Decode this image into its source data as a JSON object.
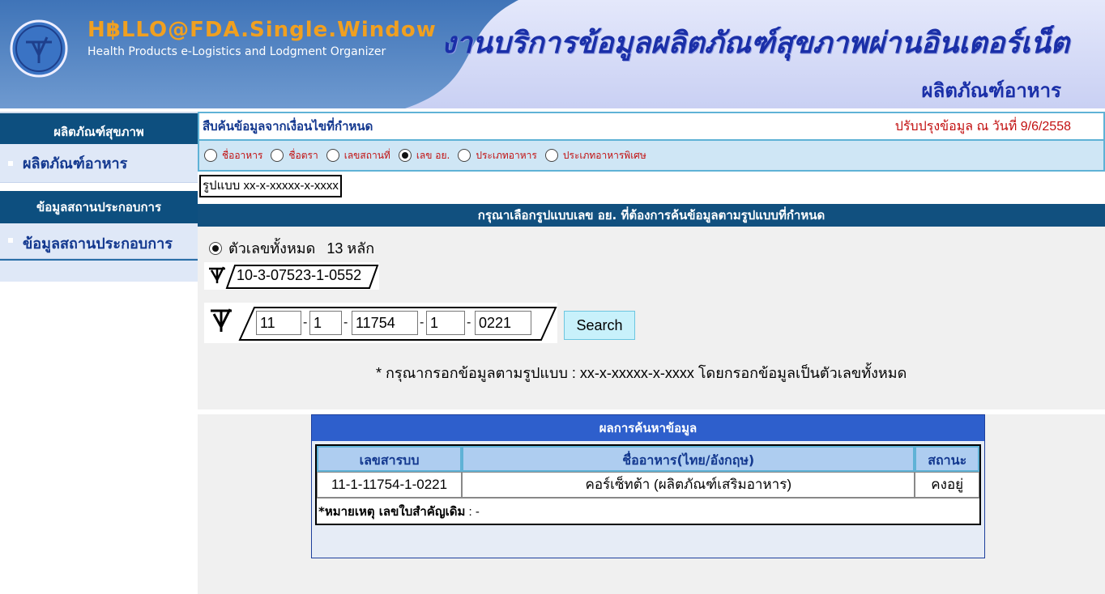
{
  "header": {
    "brand_title": "H฿LLO@FDA.Single.Window",
    "brand_subtitle": "Health Products e-Logistics and Lodgment Organizer",
    "title": "งานบริการข้อมูลผลิตภัณฑ์สุขภาพผ่านอินเตอร์เน็ต",
    "subtitle": "ผลิตภัณฑ์อาหาร"
  },
  "sidebar": {
    "section1_title": "ผลิตภัณฑ์สุขภาพ",
    "section1_item": "ผลิตภัณฑ์อาหาร",
    "section2_title": "ข้อมูลสถานประกอบการ",
    "section2_item": "ข้อมูลสถานประกอบการ"
  },
  "query": {
    "title": "สืบค้นข้อมูลจากเงื่อนไขที่กำหนด",
    "update_text": "ปรับปรุงข้อมูล ณ วันที่ 9/6/2558",
    "options": [
      {
        "label": "ชื่ออาหาร",
        "checked": false
      },
      {
        "label": "ชื่อตรา",
        "checked": false
      },
      {
        "label": "เลขสถานที่",
        "checked": false
      },
      {
        "label": "เลข อย.",
        "checked": true
      },
      {
        "label": "ประเภทอาหาร",
        "checked": false
      },
      {
        "label": "ประเภทอาหารพิเศษ",
        "checked": false
      }
    ],
    "format_label": "รูปแบบ xx-x-xxxxx-x-xxxx"
  },
  "entry": {
    "bar_title": "กรุณาเลือกรูปแบบเลข  อย. ที่ต้องการค้นข้อมูลตามรูปแบบที่กำหนด",
    "all_digits_label": "ตัวเลขทั้งหมด",
    "digits_count": "13 หลัก",
    "example": "10-3-07523-1-0552",
    "seg1": "11",
    "seg2": "1",
    "seg3": "11754",
    "seg4": "1",
    "seg5": "0221",
    "dash": "-",
    "search_label": "Search",
    "note": "* กรุณากรอกข้อมูลตามรูปแบบ   : xx-x-xxxxx-x-xxxx โดยกรอกข้อมูลเป็นตัวเลขทั้งหมด"
  },
  "result": {
    "title": "ผลการค้นหาข้อมูล",
    "headers": [
      "เลขสารบบ",
      "ชื่ออาหาร(ไทย/อังกฤษ)",
      "สถานะ"
    ],
    "row": [
      "11-1-11754-1-0221",
      "คอร์เซ็ทต้า   (ผลิตภัณฑ์เสริมอาหาร)",
      "คงอยู่"
    ],
    "remark_label": "*หมายเหตุ  เลขใบสำคัญเดิม",
    "remark_value": "  : -"
  },
  "colors": {
    "header_blue": "#1a2fa8",
    "nav_dark": "#0d4f7f",
    "result_head": "#2e5fcc",
    "update_red": "#c21010"
  }
}
